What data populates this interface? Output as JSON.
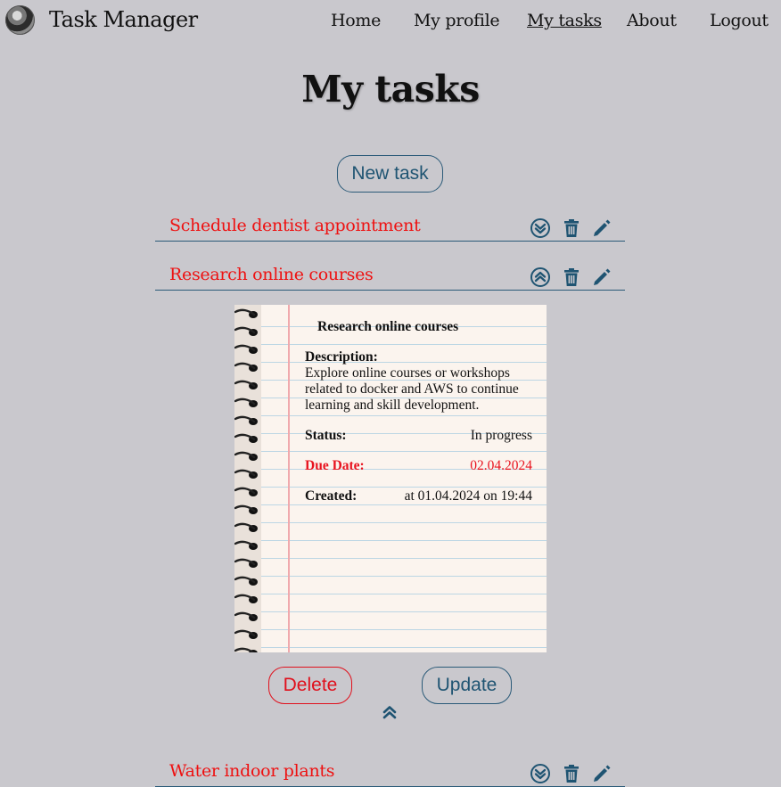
{
  "app": {
    "brand": "Task Manager"
  },
  "nav": {
    "items": [
      {
        "label": "Home",
        "active": false
      },
      {
        "label": "My profile",
        "active": false
      },
      {
        "label": "My tasks",
        "active": true
      },
      {
        "label": "About",
        "active": false
      },
      {
        "label": "Logout",
        "active": false
      }
    ]
  },
  "page": {
    "title": "My tasks",
    "new_task_label": "New task"
  },
  "tasks": [
    {
      "title": "Schedule dentist appointment",
      "expanded": false
    },
    {
      "title": "Research online courses",
      "expanded": true
    },
    {
      "title": "Water indoor plants",
      "expanded": false
    }
  ],
  "detail": {
    "title": "Research online courses",
    "description_label": "Description:",
    "description": "Explore online courses or workshops related to docker and AWS to continue learning and skill development.",
    "status_label": "Status:",
    "status": "In progress",
    "due_label": "Due Date:",
    "due": "02.04.2024",
    "created_label": "Created:",
    "created": "at 01.04.2024 on 19:44",
    "delete_label": "Delete",
    "update_label": "Update"
  },
  "icons": {
    "expand": "chevron-double-down-icon",
    "collapse": "chevron-double-up-icon",
    "delete": "trash-icon",
    "edit": "pencil-icon",
    "collapse_detail": "double-chevron-up-icon"
  },
  "colors": {
    "accent": "#1f5472",
    "danger": "#e0101c",
    "task_title": "#ee1111",
    "background": "#c9c8cd"
  }
}
